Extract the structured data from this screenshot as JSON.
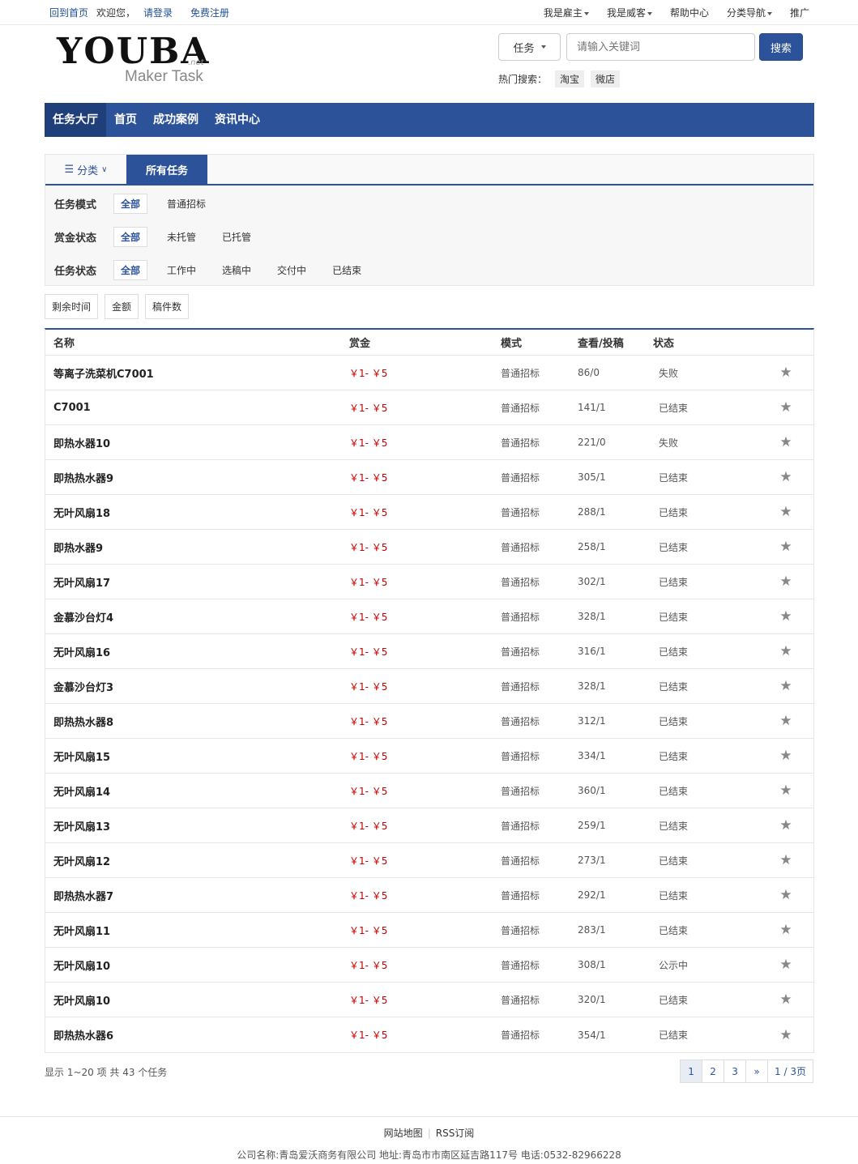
{
  "topbar": {
    "home": "回到首页",
    "welcome": "欢迎您，",
    "login": "请登录",
    "register": "免费注册",
    "right": [
      "我是雇主",
      "我是威客",
      "帮助中心",
      "分类导航",
      "推广"
    ]
  },
  "logo": {
    "main": "YOUBA",
    "net": ".net",
    "sub": "Maker Task"
  },
  "search": {
    "type": "任务",
    "placeholder": "请输入关键词",
    "button": "搜索",
    "hot_label": "热门搜索：",
    "hot_tags": [
      "淘宝",
      "微店"
    ]
  },
  "nav": [
    "任务大厅",
    "首页",
    "成功案例",
    "资讯中心"
  ],
  "filter": {
    "tab_category": "分类",
    "tab_all": "所有任务",
    "rows": [
      {
        "label": "任务模式",
        "options": [
          "全部",
          "普通招标"
        ]
      },
      {
        "label": "赏金状态",
        "options": [
          "全部",
          "未托管",
          "已托管"
        ]
      },
      {
        "label": "任务状态",
        "options": [
          "全部",
          "工作中",
          "选稿中",
          "交付中",
          "已结束"
        ]
      }
    ]
  },
  "sorts": [
    "剩余时间",
    "金额",
    "稿件数"
  ],
  "table": {
    "headers": [
      "名称",
      "赏金",
      "模式",
      "查看/投稿",
      "状态"
    ],
    "rows": [
      {
        "name": "等离子洗菜机C7001",
        "reward": "￥1- ￥5",
        "mode": "普通招标",
        "views": "86/0",
        "status": "失败"
      },
      {
        "name": "C7001",
        "reward": "￥1- ￥5",
        "mode": "普通招标",
        "views": "141/1",
        "status": "已结束"
      },
      {
        "name": "即热水器10",
        "reward": "￥1- ￥5",
        "mode": "普通招标",
        "views": "221/0",
        "status": "失败"
      },
      {
        "name": "即热热水器9",
        "reward": "￥1- ￥5",
        "mode": "普通招标",
        "views": "305/1",
        "status": "已结束"
      },
      {
        "name": "无叶风扇18",
        "reward": "￥1- ￥5",
        "mode": "普通招标",
        "views": "288/1",
        "status": "已结束"
      },
      {
        "name": "即热水器9",
        "reward": "￥1- ￥5",
        "mode": "普通招标",
        "views": "258/1",
        "status": "已结束"
      },
      {
        "name": "无叶风扇17",
        "reward": "￥1- ￥5",
        "mode": "普通招标",
        "views": "302/1",
        "status": "已结束"
      },
      {
        "name": "金慕沙台灯4",
        "reward": "￥1- ￥5",
        "mode": "普通招标",
        "views": "328/1",
        "status": "已结束"
      },
      {
        "name": "无叶风扇16",
        "reward": "￥1- ￥5",
        "mode": "普通招标",
        "views": "316/1",
        "status": "已结束"
      },
      {
        "name": "金慕沙台灯3",
        "reward": "￥1- ￥5",
        "mode": "普通招标",
        "views": "328/1",
        "status": "已结束"
      },
      {
        "name": "即热热水器8",
        "reward": "￥1- ￥5",
        "mode": "普通招标",
        "views": "312/1",
        "status": "已结束"
      },
      {
        "name": "无叶风扇15",
        "reward": "￥1- ￥5",
        "mode": "普通招标",
        "views": "334/1",
        "status": "已结束"
      },
      {
        "name": "无叶风扇14",
        "reward": "￥1- ￥5",
        "mode": "普通招标",
        "views": "360/1",
        "status": "已结束"
      },
      {
        "name": "无叶风扇13",
        "reward": "￥1- ￥5",
        "mode": "普通招标",
        "views": "259/1",
        "status": "已结束"
      },
      {
        "name": "无叶风扇12",
        "reward": "￥1- ￥5",
        "mode": "普通招标",
        "views": "273/1",
        "status": "已结束"
      },
      {
        "name": "即热热水器7",
        "reward": "￥1- ￥5",
        "mode": "普通招标",
        "views": "292/1",
        "status": "已结束"
      },
      {
        "name": "无叶风扇11",
        "reward": "￥1- ￥5",
        "mode": "普通招标",
        "views": "283/1",
        "status": "已结束"
      },
      {
        "name": "无叶风扇10",
        "reward": "￥1- ￥5",
        "mode": "普通招标",
        "views": "308/1",
        "status": "公示中"
      },
      {
        "name": "无叶风扇10",
        "reward": "￥1- ￥5",
        "mode": "普通招标",
        "views": "320/1",
        "status": "已结束"
      },
      {
        "name": "即热热水器6",
        "reward": "￥1- ￥5",
        "mode": "普通招标",
        "views": "354/1",
        "status": "已结束"
      }
    ]
  },
  "summary": "显示 1~20 项 共 43 个任务",
  "pager": {
    "pages": [
      "1",
      "2",
      "3"
    ],
    "next": "»",
    "total": "1 / 3页"
  },
  "footer": {
    "links": [
      "网站地图",
      "RSS订阅"
    ],
    "info": "公司名称:青岛爱沃商务有限公司 地址:青岛市市南区延吉路117号 电话:0532-82966228"
  }
}
